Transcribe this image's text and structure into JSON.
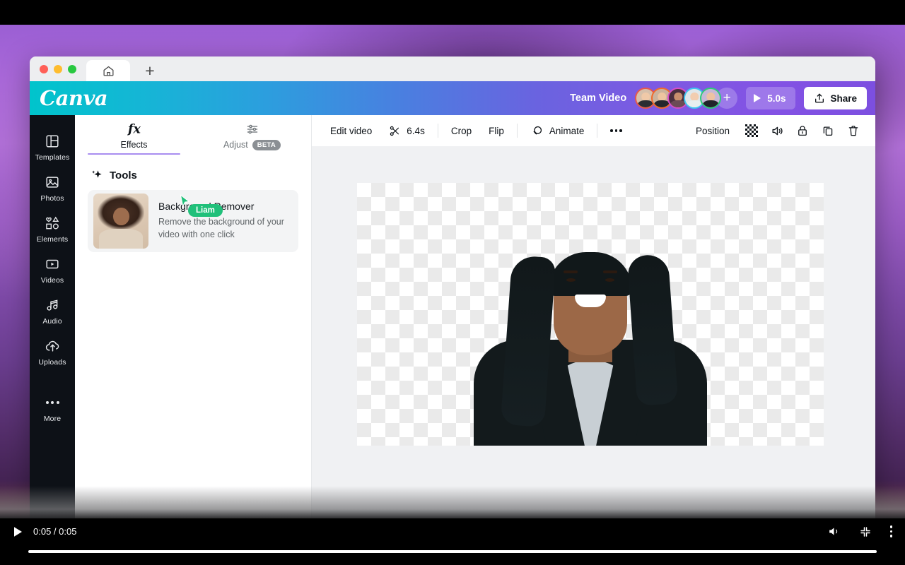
{
  "browser": {
    "traffic_lights": [
      "close",
      "minimize",
      "maximize"
    ],
    "home_tab_icon": "home-icon",
    "new_tab_label": "+"
  },
  "app_header": {
    "logo_text": "Canva",
    "document_title": "Team Video",
    "collaborators": [
      {
        "ring_color": "#e8584a"
      },
      {
        "ring_color": "#f06a2a"
      },
      {
        "ring_color": "#d64fc4"
      },
      {
        "ring_color": "#3fc4f0"
      },
      {
        "ring_color": "#2fc97a"
      }
    ],
    "add_collaborator_label": "+",
    "play_duration": "5.0s",
    "share_label": "Share"
  },
  "sidebar": {
    "items": [
      {
        "label": "Templates",
        "icon": "templates-icon"
      },
      {
        "label": "Photos",
        "icon": "photos-icon"
      },
      {
        "label": "Elements",
        "icon": "elements-icon"
      },
      {
        "label": "Videos",
        "icon": "videos-icon"
      },
      {
        "label": "Audio",
        "icon": "audio-icon"
      },
      {
        "label": "Uploads",
        "icon": "uploads-icon"
      },
      {
        "label": "More",
        "icon": "more-icon"
      }
    ]
  },
  "panel": {
    "tabs": [
      {
        "label": "Effects",
        "icon": "fx-icon",
        "active": true,
        "badge": ""
      },
      {
        "label": "Adjust",
        "icon": "sliders-icon",
        "active": false,
        "badge": "BETA"
      }
    ],
    "section_title": "Tools",
    "section_icon": "sparkle-icon",
    "tool_card": {
      "title": "Background Remover",
      "description": "Remove the background of your video with one click"
    }
  },
  "collaborator_cursor": {
    "name": "Liam",
    "color": "#20c07a"
  },
  "editor_toolbar": {
    "edit_video_label": "Edit video",
    "trim_icon": "scissors-icon",
    "trim_duration": "6.4s",
    "crop_label": "Crop",
    "flip_label": "Flip",
    "animate_label": "Animate",
    "animate_icon": "animate-icon",
    "more_icon": "more-horizontal-icon",
    "position_label": "Position",
    "right_icons": [
      {
        "name": "transparency-icon"
      },
      {
        "name": "volume-icon"
      },
      {
        "name": "lock-icon"
      },
      {
        "name": "duplicate-icon"
      },
      {
        "name": "trash-icon"
      }
    ]
  },
  "canvas": {
    "background": "transparent-checkerboard",
    "subject_alt": "Person with braided hair wearing dark blazer and light gray top"
  },
  "recorder_player": {
    "play_icon": "play-icon",
    "time_display": "0:05 / 0:05",
    "volume_icon": "volume-icon",
    "fullscreen_icon": "minimize-icon",
    "menu_icon": "more-vertical-icon"
  },
  "colors": {
    "accent_purple": "#a98df0",
    "canva_cyan": "#00c4cc",
    "canva_violet": "#7c4fe0",
    "collab_green": "#20c07a",
    "rail_dark": "#0d1117"
  }
}
